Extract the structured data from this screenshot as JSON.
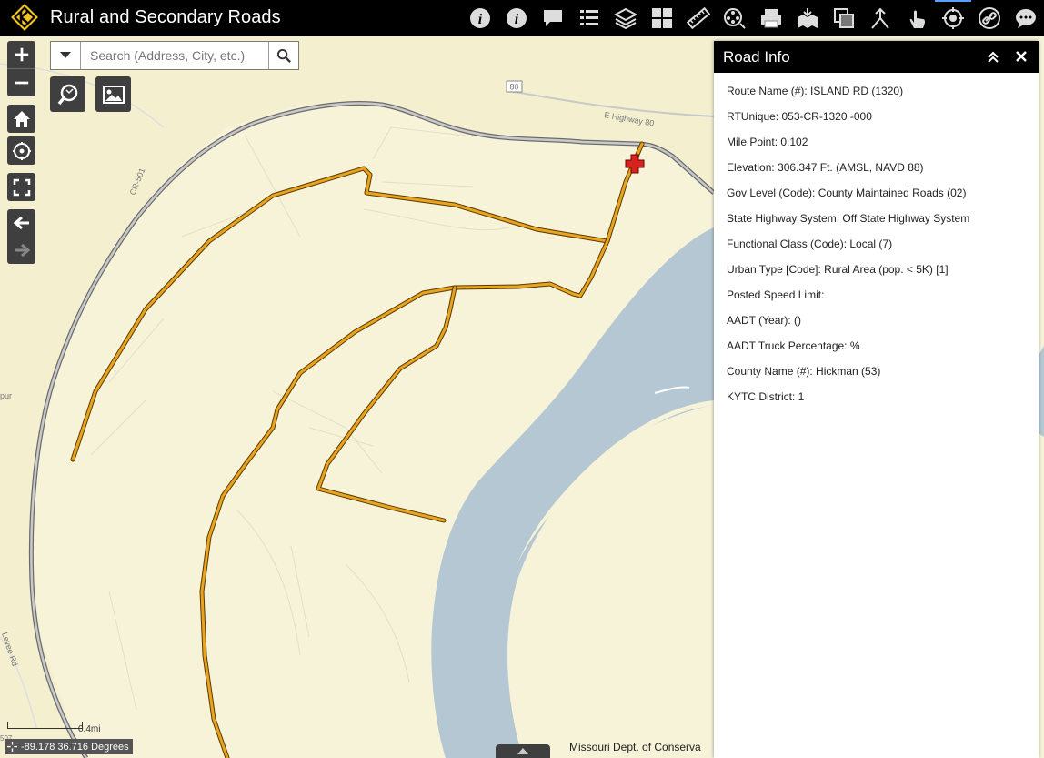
{
  "header": {
    "title": "Rural and Secondary Roads",
    "tools": [
      {
        "name": "about-icon"
      },
      {
        "name": "info-icon"
      },
      {
        "name": "chat-icon"
      },
      {
        "name": "legend-icon"
      },
      {
        "name": "layers-icon"
      },
      {
        "name": "basemap-gallery-icon"
      },
      {
        "name": "measure-icon"
      },
      {
        "name": "film-icon"
      },
      {
        "name": "print-icon"
      },
      {
        "name": "add-data-icon"
      },
      {
        "name": "swipe-icon"
      },
      {
        "name": "directions-icon"
      },
      {
        "name": "touch-icon"
      },
      {
        "name": "road-info-icon"
      },
      {
        "name": "link-icon"
      },
      {
        "name": "feedback-icon"
      }
    ],
    "active_tool": "road-info-icon"
  },
  "search": {
    "placeholder": "Search (Address, City, etc.)"
  },
  "map": {
    "labels": {
      "highway_shield": "80",
      "highway_name": "E Highway 80",
      "county_road": "CR-501",
      "left_road": "pur",
      "levee_road": "Levee Rd",
      "bottom_left": "507"
    },
    "scale_label": "0.4mi",
    "coordinates": "-89.178 36.716 Degrees",
    "attribution": "Missouri Dept. of Conserva",
    "colors": {
      "land": "#f6f3d8",
      "water": "#b5c7d3",
      "road": "#e8a320",
      "road_outline": "#5a3a00",
      "highway": "#9a9a9a",
      "marker": "#d8221e"
    }
  },
  "panel": {
    "title": "Road Info",
    "rows": [
      "Route Name (#): ISLAND RD (1320)",
      "RTUnique: 053-CR-1320 -000",
      "Mile Point: 0.102",
      "Elevation: 306.347 Ft. (AMSL, NAVD 88)",
      "Gov Level (Code): County Maintained Roads (02)",
      "State Highway System: Off State Highway System",
      "Functional Class (Code): Local (7)",
      "Urban Type [Code]: Rural Area (pop. < 5K) [1]",
      "Posted Speed Limit:",
      "AADT (Year):  ()",
      "AADT Truck Percentage: %",
      "County Name (#): Hickman (53)",
      "KYTC District: 1"
    ]
  }
}
